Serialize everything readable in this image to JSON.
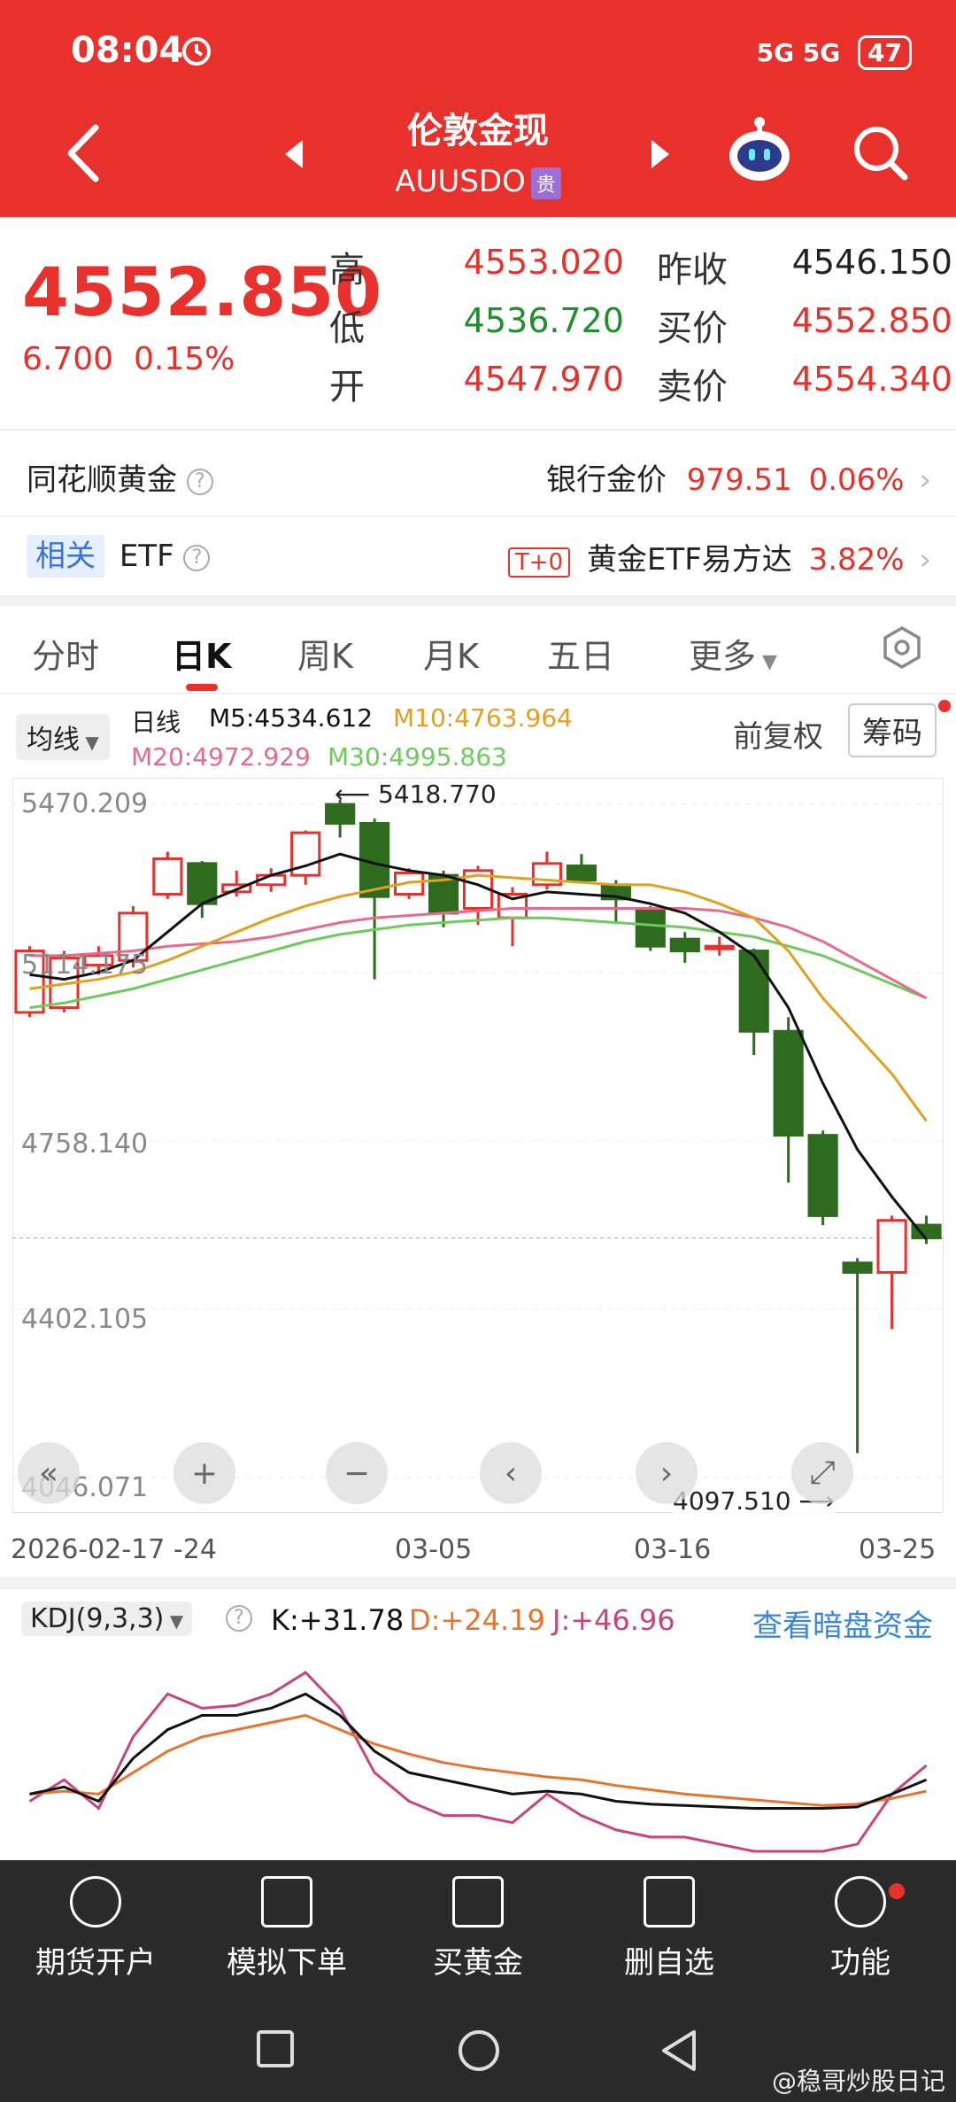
{
  "status": {
    "time": "08:04",
    "network": "5G 5G",
    "battery": "47"
  },
  "header": {
    "title": "伦敦金现",
    "symbol": "AUUSDO",
    "tag": "贵"
  },
  "quote": {
    "price": "4552.850",
    "change": "6.700",
    "change_pct": "0.15%",
    "high_label": "高",
    "high": "4553.020",
    "low_label": "低",
    "low": "4536.720",
    "open_label": "开",
    "open": "4547.970",
    "prev_label": "昨收",
    "prev": "4546.150",
    "bid_label": "买价",
    "bid": "4552.850",
    "ask_label": "卖价",
    "ask": "4554.340"
  },
  "bank": {
    "left": "同花顺黄金",
    "label": "银行金价",
    "price": "979.51",
    "pct": "0.06%"
  },
  "etf": {
    "tag": "相关",
    "label": "ETF",
    "t0": "T+0",
    "name": "黄金ETF易方达",
    "pct": "3.82%"
  },
  "tabs": [
    "分时",
    "日K",
    "周K",
    "月K",
    "五日",
    "更多"
  ],
  "ma": {
    "selector": "均线",
    "daily": "日线",
    "m5": "M5:4534.612",
    "m10": "M10:4763.964",
    "m20": "M20:4972.929",
    "m30": "M30:4995.863",
    "adjust": "前复权",
    "chip": "筹码",
    "c5": "#111111",
    "c10": "#e0a020",
    "c20": "#e86a8a",
    "c30": "#6ccb5a"
  },
  "chart_data": {
    "type": "candlestick",
    "y_ticks": [
      "5470.209",
      "5114.175",
      "4758.140",
      "4402.105",
      "4046.071"
    ],
    "x_ticks": [
      "2026-02-17",
      "-24",
      "03-05",
      "03-16",
      "03-25"
    ],
    "high_annotation": "5418.770",
    "low_annotation": "4097.510",
    "ylim": [
      4046.071,
      5470.209
    ],
    "candles": [
      {
        "o": 5030,
        "c": 5160,
        "h": 5170,
        "l": 5020
      },
      {
        "o": 5040,
        "c": 5145,
        "h": 5160,
        "l": 5030
      },
      {
        "o": 5130,
        "c": 5150,
        "h": 5170,
        "l": 5110
      },
      {
        "o": 5140,
        "c": 5240,
        "h": 5255,
        "l": 5125
      },
      {
        "o": 5280,
        "c": 5355,
        "h": 5370,
        "l": 5270
      },
      {
        "o": 5345,
        "c": 5260,
        "h": 5350,
        "l": 5230
      },
      {
        "o": 5285,
        "c": 5300,
        "h": 5330,
        "l": 5275
      },
      {
        "o": 5300,
        "c": 5320,
        "h": 5335,
        "l": 5285
      },
      {
        "o": 5320,
        "c": 5410,
        "h": 5415,
        "l": 5300
      },
      {
        "o": 5470,
        "c": 5430,
        "h": 5480,
        "l": 5400
      },
      {
        "o": 5430,
        "c": 5275,
        "h": 5440,
        "l": 5100
      },
      {
        "o": 5280,
        "c": 5325,
        "h": 5335,
        "l": 5270
      },
      {
        "o": 5320,
        "c": 5240,
        "h": 5330,
        "l": 5210
      },
      {
        "o": 5250,
        "c": 5330,
        "h": 5340,
        "l": 5215
      },
      {
        "o": 5230,
        "c": 5280,
        "h": 5295,
        "l": 5170
      },
      {
        "o": 5300,
        "c": 5345,
        "h": 5370,
        "l": 5290
      },
      {
        "o": 5340,
        "c": 5310,
        "h": 5365,
        "l": 5305
      },
      {
        "o": 5300,
        "c": 5270,
        "h": 5310,
        "l": 5220
      },
      {
        "o": 5250,
        "c": 5170,
        "h": 5255,
        "l": 5160
      },
      {
        "o": 5185,
        "c": 5160,
        "h": 5200,
        "l": 5135
      },
      {
        "o": 5170,
        "c": 5170,
        "h": 5190,
        "l": 5150
      },
      {
        "o": 5160,
        "c": 4990,
        "h": 5165,
        "l": 4940
      },
      {
        "o": 4990,
        "c": 4770,
        "h": 5020,
        "l": 4670
      },
      {
        "o": 4770,
        "c": 4600,
        "h": 4780,
        "l": 4580
      },
      {
        "o": 4500,
        "c": 4480,
        "h": 4510,
        "l": 4097.51
      },
      {
        "o": 4480,
        "c": 4590,
        "h": 4600,
        "l": 4360
      },
      {
        "o": 4580,
        "c": 4553,
        "h": 4600,
        "l": 4540
      }
    ],
    "ma5": [
      5110,
      5100,
      5115,
      5140,
      5200,
      5260,
      5290,
      5320,
      5340,
      5365,
      5345,
      5330,
      5320,
      5300,
      5270,
      5285,
      5280,
      5275,
      5260,
      5240,
      5200,
      5150,
      5040,
      4880,
      4740,
      4640,
      4550
    ],
    "ma10": [
      5080,
      5090,
      5100,
      5115,
      5140,
      5170,
      5200,
      5230,
      5255,
      5275,
      5290,
      5305,
      5310,
      5320,
      5315,
      5310,
      5305,
      5300,
      5300,
      5285,
      5260,
      5230,
      5160,
      5060,
      4980,
      4900,
      4800
    ],
    "ma20": [
      5150,
      5150,
      5155,
      5160,
      5170,
      5175,
      5180,
      5190,
      5205,
      5220,
      5230,
      5235,
      5240,
      5245,
      5250,
      5250,
      5250,
      5250,
      5250,
      5250,
      5245,
      5230,
      5210,
      5180,
      5140,
      5100,
      5060
    ],
    "ma30": [
      5040,
      5050,
      5065,
      5080,
      5100,
      5120,
      5140,
      5160,
      5180,
      5195,
      5205,
      5215,
      5220,
      5225,
      5230,
      5230,
      5225,
      5220,
      5215,
      5210,
      5200,
      5190,
      5170,
      5150,
      5120,
      5090,
      5060
    ],
    "ref_price": 4552.85
  },
  "kdj": {
    "label": "KDJ(9,3,3)",
    "k": "K:+31.78",
    "d": "D:+24.19",
    "j": "J:+46.96",
    "link": "查看暗盘资金",
    "k_vals": [
      10,
      15,
      5,
      35,
      55,
      65,
      65,
      70,
      80,
      65,
      40,
      25,
      20,
      15,
      10,
      12,
      10,
      5,
      3,
      2,
      1,
      0,
      0,
      0,
      1,
      10,
      20
    ],
    "d_vals": [
      10,
      12,
      10,
      25,
      40,
      50,
      55,
      60,
      65,
      55,
      45,
      38,
      32,
      28,
      25,
      22,
      20,
      16,
      13,
      10,
      8,
      6,
      4,
      2,
      3,
      7,
      12
    ],
    "j_vals": [
      5,
      20,
      0,
      50,
      80,
      70,
      72,
      80,
      95,
      70,
      25,
      5,
      -5,
      -5,
      -10,
      10,
      -5,
      -15,
      -20,
      -20,
      -25,
      -30,
      -30,
      -30,
      -25,
      10,
      30
    ]
  },
  "bottom": [
    "期货开户",
    "模拟下单",
    "买黄金",
    "删自选",
    "功能"
  ],
  "watermark": "@稳哥炒股日记"
}
